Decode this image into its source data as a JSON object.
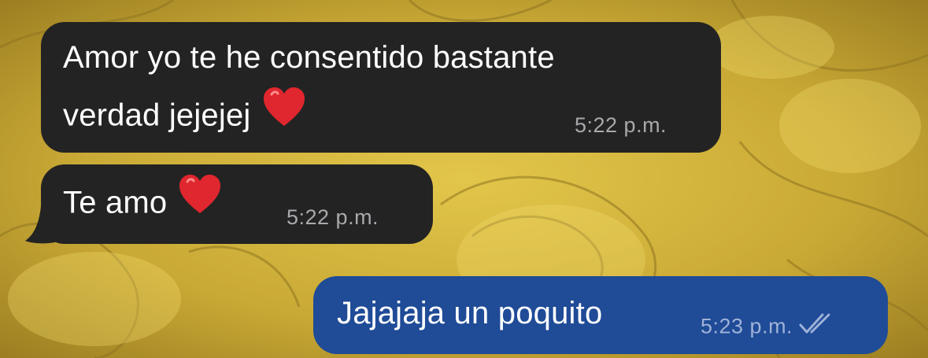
{
  "chat": {
    "messages": [
      {
        "direction": "incoming",
        "line1": "Amor yo te he consentido bastante",
        "line2": "verdad jejejej",
        "emoji": "heart-emoji",
        "time": "5:22 p.m."
      },
      {
        "direction": "incoming",
        "line1": "Te amo",
        "emoji": "heart-emoji",
        "time": "5:22 p.m."
      },
      {
        "direction": "outgoing",
        "line1": "Jajajaja un poquito",
        "time": "5:23 p.m.",
        "status_icon": "double-check-icon"
      }
    ]
  },
  "colors": {
    "incoming_bubble": "#232323",
    "outgoing_bubble": "#1f4b97",
    "wallpaper": "#cfb13a",
    "heart": "#e0262e"
  }
}
